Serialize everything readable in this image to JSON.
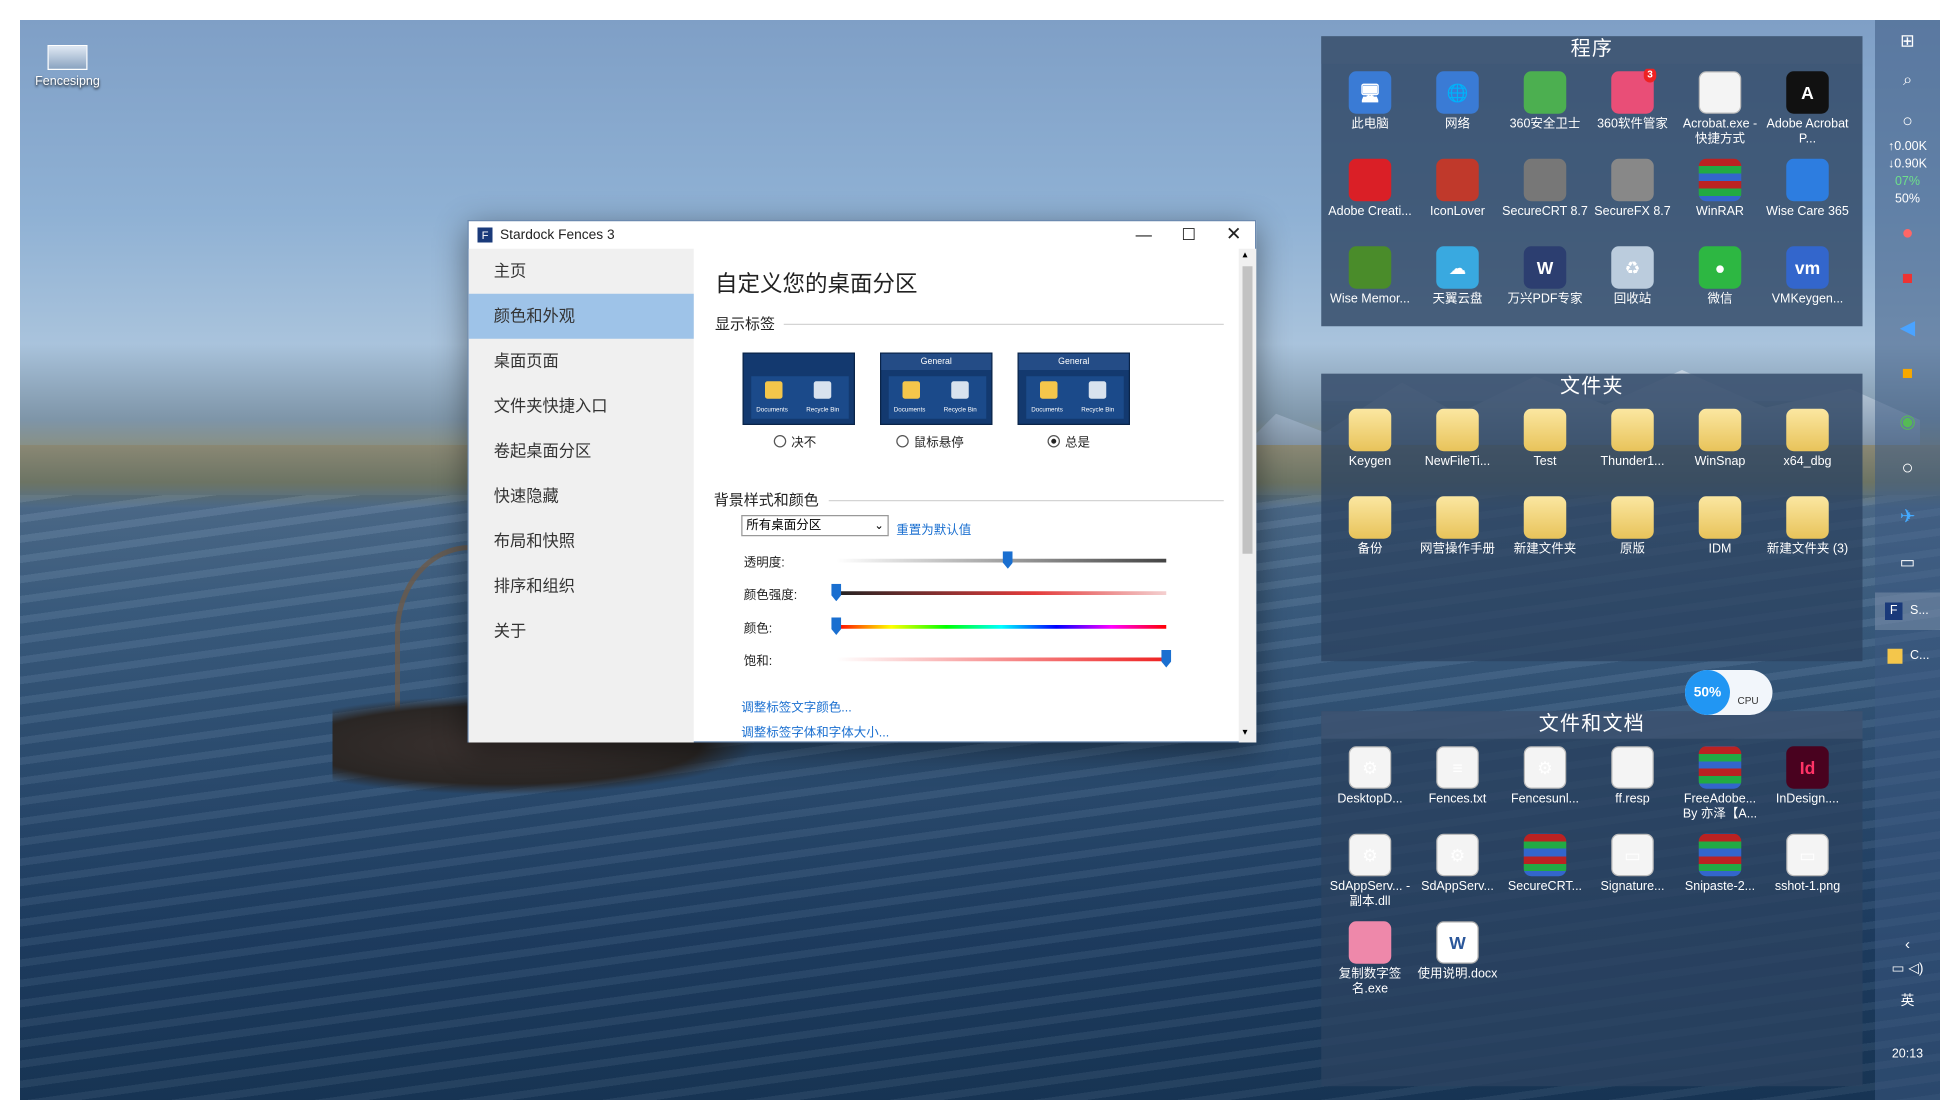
{
  "desktop": {
    "icon_label": "Fencesipng"
  },
  "fences": [
    {
      "title": "程序",
      "items": [
        {
          "label": "此电脑",
          "icon": "computer-icon"
        },
        {
          "label": "网络",
          "icon": "network-icon"
        },
        {
          "label": "360安全卫士",
          "icon": "360-security-icon"
        },
        {
          "label": "360软件管家",
          "icon": "360-software-manager-icon",
          "badge": "3"
        },
        {
          "label": "Acrobat.exe - 快捷方式",
          "icon": "file-icon"
        },
        {
          "label": "Adobe Acrobat P...",
          "icon": "acrobat-icon"
        },
        {
          "label": "Adobe Creati...",
          "icon": "creative-cloud-icon"
        },
        {
          "label": "IconLover",
          "icon": "heart-icon"
        },
        {
          "label": "SecureCRT 8.7",
          "icon": "securecrt-icon"
        },
        {
          "label": "SecureFX 8.7",
          "icon": "securefx-icon"
        },
        {
          "label": "WinRAR",
          "icon": "winrar-icon"
        },
        {
          "label": "Wise Care 365",
          "icon": "wise-care-icon"
        },
        {
          "label": "Wise Memor...",
          "icon": "memory-icon"
        },
        {
          "label": "天翼云盘",
          "icon": "cloud-drive-icon"
        },
        {
          "label": "万兴PDF专家",
          "icon": "pdf-expert-icon"
        },
        {
          "label": "回收站",
          "icon": "recycle-bin-icon"
        },
        {
          "label": "微信",
          "icon": "wechat-icon"
        },
        {
          "label": "VMKeygen...",
          "icon": "vmware-icon"
        }
      ]
    },
    {
      "title": "文件夹",
      "items": [
        {
          "label": "Keygen",
          "icon": "folder-icon"
        },
        {
          "label": "NewFileTi...",
          "icon": "folder-icon"
        },
        {
          "label": "Test",
          "icon": "folder-icon"
        },
        {
          "label": "Thunder1...",
          "icon": "folder-icon"
        },
        {
          "label": "WinSnap",
          "icon": "folder-icon"
        },
        {
          "label": "x64_dbg",
          "icon": "folder-icon"
        },
        {
          "label": "备份",
          "icon": "folder-icon"
        },
        {
          "label": "网营操作手册",
          "icon": "folder-icon"
        },
        {
          "label": "新建文件夹",
          "icon": "folder-icon"
        },
        {
          "label": "原版",
          "icon": "folder-icon"
        },
        {
          "label": "IDM",
          "icon": "folder-icon"
        },
        {
          "label": "新建文件夹 (3)",
          "icon": "folder-icon"
        }
      ]
    },
    {
      "title": "文件和文档",
      "items": [
        {
          "label": "DesktopD...",
          "icon": "settings-file-icon"
        },
        {
          "label": "Fences.txt",
          "icon": "text-file-icon"
        },
        {
          "label": "Fencesunl...",
          "icon": "settings-file-icon"
        },
        {
          "label": "ff.resp",
          "icon": "file-icon"
        },
        {
          "label": "FreeAdobe... By 亦泽【A...",
          "icon": "winrar-icon"
        },
        {
          "label": "InDesign....",
          "icon": "indesign-icon"
        },
        {
          "label": "SdAppServ... - 副本.dll",
          "icon": "settings-file-icon"
        },
        {
          "label": "SdAppServ...",
          "icon": "settings-file-icon"
        },
        {
          "label": "SecureCRT...",
          "icon": "winrar-icon"
        },
        {
          "label": "Signature...",
          "icon": "image-file-icon"
        },
        {
          "label": "Snipaste-2...",
          "icon": "winrar-icon"
        },
        {
          "label": "sshot-1.png",
          "icon": "image-file-icon"
        },
        {
          "label": "复制数字签名.exe",
          "icon": "butterfly-icon"
        },
        {
          "label": "使用说明.docx",
          "icon": "word-icon"
        }
      ]
    }
  ],
  "cpu_widget": {
    "percent": "50%",
    "label": "CPU"
  },
  "taskbar": {
    "net_up": "↑0.00K",
    "net_down": "↓0.90K",
    "mem": "07%",
    "cpu": "50%",
    "task_fences": "S...",
    "task_folder": "C...",
    "ime": "英",
    "time": "20:13"
  },
  "window": {
    "title": "Stardock Fences 3",
    "nav": [
      "主页",
      "颜色和外观",
      "桌面页面",
      "文件夹快捷入口",
      "卷起桌面分区",
      "快速隐藏",
      "布局和快照",
      "排序和组织",
      "关于"
    ],
    "active_nav": 1,
    "heading": "自定义您的桌面分区",
    "section_labels": "显示标签",
    "preview_title": "General",
    "preview_docs": "Documents",
    "preview_bin": "Recycle Bin",
    "label_options": [
      {
        "label": "决不",
        "selected": false
      },
      {
        "label": "鼠标悬停",
        "selected": false
      },
      {
        "label": "总是",
        "selected": true
      }
    ],
    "section_bg": "背景样式和颜色",
    "select_value": "所有桌面分区",
    "reset_link": "重置为默认值",
    "sliders": [
      {
        "label": "透明度:",
        "value": 0.52
      },
      {
        "label": "颜色强度:",
        "value": 0.0
      },
      {
        "label": "颜色:",
        "value": 0.0
      },
      {
        "label": "饱和:",
        "value": 1.0
      }
    ],
    "link_text_color": "调整标签文字颜色...",
    "link_font": "调整标签字体和字体大小..."
  }
}
